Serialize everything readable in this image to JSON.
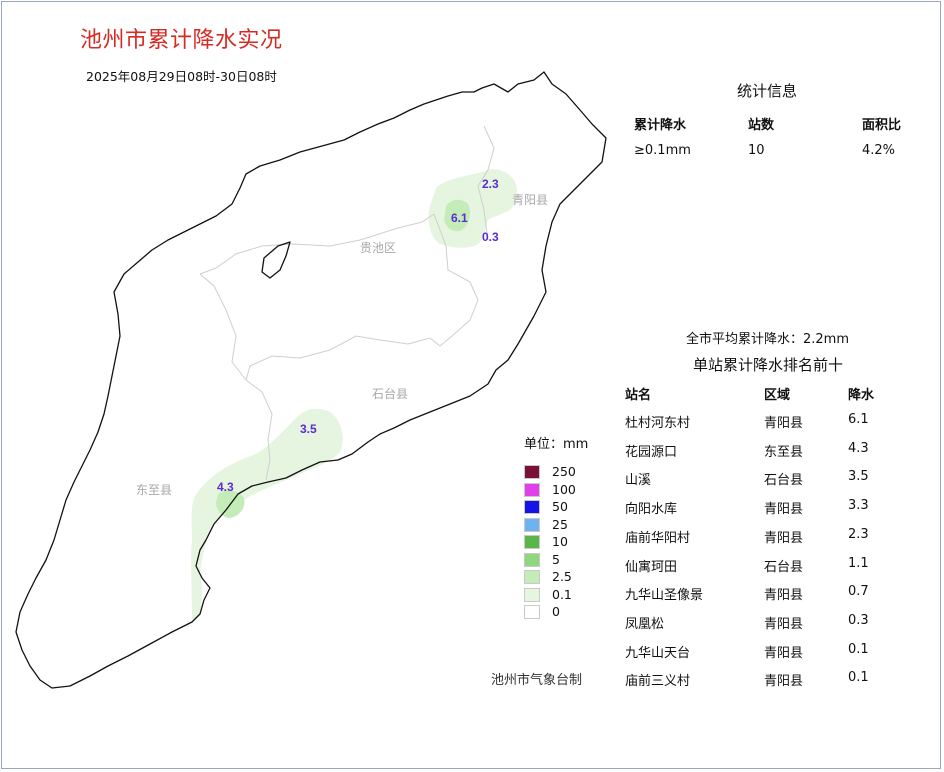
{
  "title": "池州市累计降水实况",
  "subtitle": "2025年08月29日08时-30日08时",
  "stats": {
    "title": "统计信息",
    "headers": [
      "累计降水",
      "站数",
      "面积比"
    ],
    "row": [
      "≥0.1mm",
      "10",
      "4.2%"
    ]
  },
  "average": "全市平均累计降水：2.2mm",
  "ranking": {
    "title": "单站累计降水排名前十",
    "headers": [
      "站名",
      "区域",
      "降水"
    ],
    "rows": [
      [
        "杜村河东村",
        "青阳县",
        "6.1"
      ],
      [
        "花园源口",
        "东至县",
        "4.3"
      ],
      [
        "山溪",
        "石台县",
        "3.5"
      ],
      [
        "向阳水库",
        "青阳县",
        "3.3"
      ],
      [
        "庙前华阳村",
        "青阳县",
        "2.3"
      ],
      [
        "仙寓珂田",
        "石台县",
        "1.1"
      ],
      [
        "九华山圣像景",
        "青阳县",
        "0.7"
      ],
      [
        "凤凰松",
        "青阳县",
        "0.3"
      ],
      [
        "九华山天台",
        "青阳县",
        "0.1"
      ],
      [
        "庙前三义村",
        "青阳县",
        "0.1"
      ]
    ]
  },
  "legend": {
    "title": "单位：mm",
    "items": [
      {
        "label": "250",
        "color": "#7a1238"
      },
      {
        "label": "100",
        "color": "#e040e8"
      },
      {
        "label": "50",
        "color": "#1414e6"
      },
      {
        "label": "25",
        "color": "#6fb2f2"
      },
      {
        "label": "10",
        "color": "#5ab64a"
      },
      {
        "label": "5",
        "color": "#8fd67e"
      },
      {
        "label": "2.5",
        "color": "#c4ecb8"
      },
      {
        "label": "0.1",
        "color": "#e6f5e0"
      },
      {
        "label": "0",
        "color": "#ffffff"
      }
    ]
  },
  "map": {
    "districts": [
      "贵池区",
      "青阳县",
      "石台县",
      "东至县"
    ],
    "station_values": [
      "2.3",
      "6.1",
      "0.3",
      "3.5",
      "4.3"
    ],
    "colors": {
      "outline": "#111111",
      "inner_border": "#cfcfcf",
      "district_label": "#a8a8a8",
      "value_label": "#5a2bd6"
    }
  },
  "credit": "池州市气象台制"
}
